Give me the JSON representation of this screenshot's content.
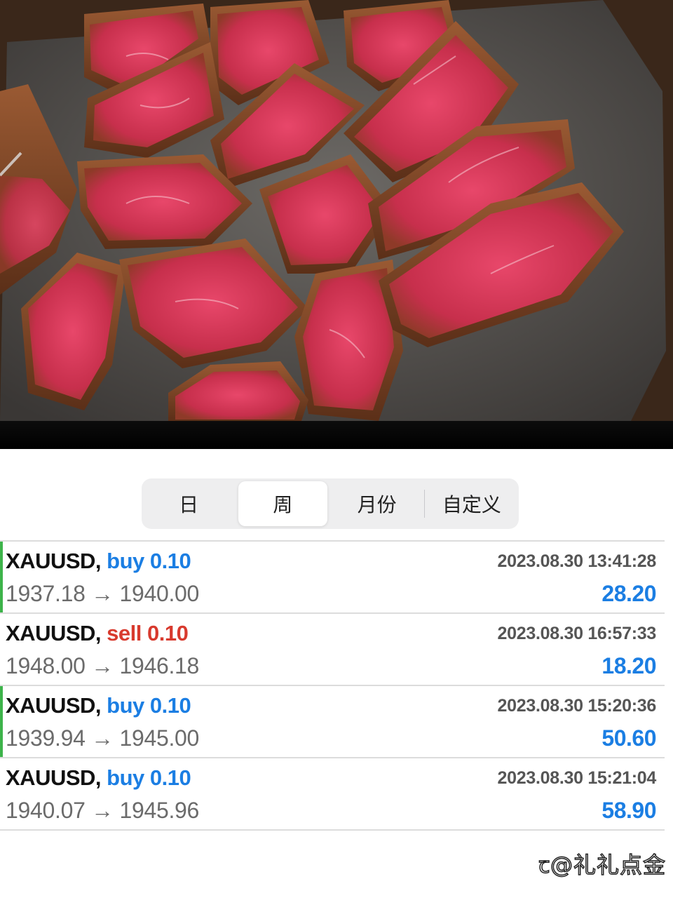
{
  "photo": {
    "subject": "seared-beef-on-stone-grill"
  },
  "tabs": [
    {
      "label": "日",
      "active": false
    },
    {
      "label": "周",
      "active": true
    },
    {
      "label": "月份",
      "active": false
    },
    {
      "label": "自定义",
      "active": false
    }
  ],
  "trades": [
    {
      "symbol": "XAUUSD,",
      "side": "buy",
      "volume": "0.10",
      "time": "2023.08.30 13:41:28",
      "open": "1937.18",
      "arrow": "→",
      "close": "1940.00",
      "profit": "28.20",
      "marker": true
    },
    {
      "symbol": "XAUUSD,",
      "side": "sell",
      "volume": "0.10",
      "time": "2023.08.30 16:57:33",
      "open": "1948.00",
      "arrow": "→",
      "close": "1946.18",
      "profit": "18.20",
      "marker": false
    },
    {
      "symbol": "XAUUSD,",
      "side": "buy",
      "volume": "0.10",
      "time": "2023.08.30 15:20:36",
      "open": "1939.94",
      "arrow": "→",
      "close": "1945.00",
      "profit": "50.60",
      "marker": true
    },
    {
      "symbol": "XAUUSD,",
      "side": "buy",
      "volume": "0.10",
      "time": "2023.08.30 15:21:04",
      "open": "1940.07",
      "arrow": "→",
      "close": "1945.96",
      "profit": "58.90",
      "marker": false
    }
  ],
  "watermark": {
    "text": "ꞇ@礼礼点金"
  },
  "colors": {
    "buy": "#1b7ee3",
    "sell": "#d83a2e",
    "profit": "#1b7ee3",
    "marker": "#3db34a"
  }
}
